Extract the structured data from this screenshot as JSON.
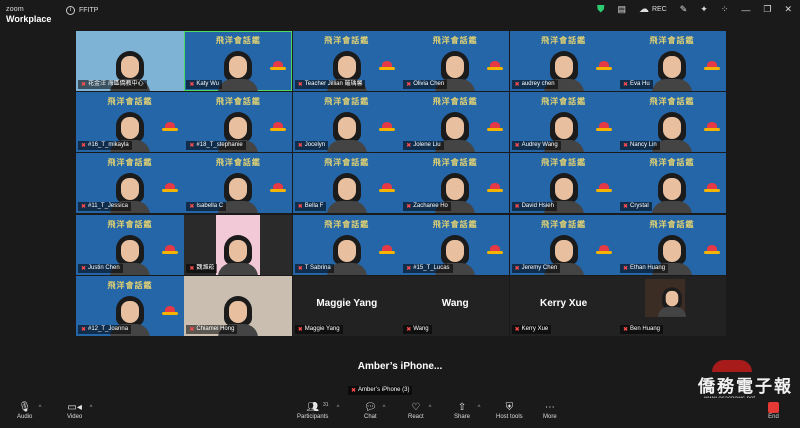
{
  "app": {
    "brand_top": "zoom",
    "brand_bottom": "Workplace",
    "meeting_name": "FFITP",
    "rec_label": "REC"
  },
  "tiles": [
    {
      "label": "花金汪 海區僑教中心",
      "variant": "photo-light"
    },
    {
      "label": "Katy Wu",
      "variant": "blue",
      "selected": true
    },
    {
      "label": "Teacher Jillian 羅瑀馨",
      "variant": "blue"
    },
    {
      "label": "Olivia Chen",
      "variant": "blue"
    },
    {
      "label": "audrey chen",
      "variant": "blue"
    },
    {
      "label": "Eva Hu",
      "variant": "blue"
    },
    {
      "label": "#16_T_mikayla",
      "variant": "blue"
    },
    {
      "label": "#18_T_stephanie",
      "variant": "blue"
    },
    {
      "label": "Jocelyn",
      "variant": "blue"
    },
    {
      "label": "Jolene Liu",
      "variant": "blue"
    },
    {
      "label": "Audrey Wang",
      "variant": "blue"
    },
    {
      "label": "Nancy  Lin",
      "variant": "blue"
    },
    {
      "label": "#11_T_Jessica",
      "variant": "blue"
    },
    {
      "label": "Isabella C",
      "variant": "blue"
    },
    {
      "label": "Bella F",
      "variant": "blue"
    },
    {
      "label": "Zacharee Ho",
      "variant": "blue"
    },
    {
      "label": "David Hsieh",
      "variant": "blue"
    },
    {
      "label": "Crystal",
      "variant": "blue"
    },
    {
      "label": "Justin Chen",
      "variant": "blue"
    },
    {
      "label": "魏濰菘",
      "variant": "photo-pink"
    },
    {
      "label": "T Sabrina",
      "variant": "blue"
    },
    {
      "label": "#15_T_Lucas",
      "variant": "blue"
    },
    {
      "label": "Jeremy Chen",
      "variant": "blue"
    },
    {
      "label": "Ethan Huang",
      "variant": "blue"
    },
    {
      "label": "#12_T_Joanna",
      "variant": "blue"
    },
    {
      "label": "Chiamei Hong",
      "variant": "photo-room"
    },
    {
      "label": "Maggie Yang",
      "variant": "name-only",
      "big_name": "Maggie Yang"
    },
    {
      "label": "Wang",
      "variant": "name-only",
      "big_name": "Wang"
    },
    {
      "label": "Kerry Xue",
      "variant": "name-only",
      "big_name": "Kerry Xue"
    },
    {
      "label": "Ben Huang",
      "variant": "photo-dark"
    }
  ],
  "background_text": "飛洋會話鑑",
  "amber": {
    "big_name": "Amber’s  iPhone...",
    "label": "Amber’s iPhone (3)"
  },
  "watermark": {
    "title": "僑務電子報",
    "url": "www.ocacnews.net"
  },
  "toolbar": {
    "audio": "Audio",
    "video": "Video",
    "participants": "Participants",
    "participants_count": "31",
    "chat": "Chat",
    "react": "React",
    "share": "Share",
    "host_tools": "Host tools",
    "more": "More",
    "end": "End"
  },
  "colors": {
    "tile_blue": "#2566a8",
    "selected_outline": "#4cd964",
    "end_red": "#e53935",
    "secure_green": "#2ecc71"
  }
}
